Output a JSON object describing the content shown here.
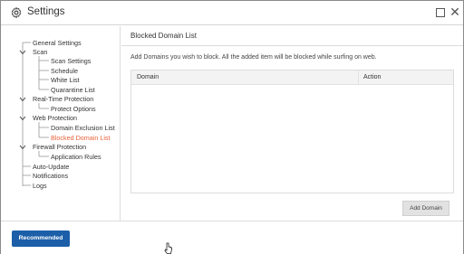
{
  "window": {
    "title": "Settings",
    "icon": "gear-icon"
  },
  "sidebar": {
    "items": [
      {
        "label": "General Settings",
        "level": 0
      },
      {
        "label": "Scan",
        "level": 0,
        "expandable": true
      },
      {
        "label": "Scan Settings",
        "level": 1
      },
      {
        "label": "Schedule",
        "level": 1
      },
      {
        "label": "White List",
        "level": 1
      },
      {
        "label": "Quarantine List",
        "level": 1
      },
      {
        "label": "Real-Time Protection",
        "level": 0,
        "expandable": true
      },
      {
        "label": "Protect Options",
        "level": 1
      },
      {
        "label": "Web Protection",
        "level": 0,
        "expandable": true
      },
      {
        "label": "Domain Exclusion List",
        "level": 1
      },
      {
        "label": "Blocked Domain List",
        "level": 1,
        "active": true
      },
      {
        "label": "Firewall Protection",
        "level": 0,
        "expandable": true
      },
      {
        "label": "Application Rules",
        "level": 1
      },
      {
        "label": "Auto-Update",
        "level": 0
      },
      {
        "label": "Notifications",
        "level": 0
      },
      {
        "label": "Logs",
        "level": 0
      }
    ]
  },
  "panel": {
    "title": "Blocked Domain List",
    "description": "Add Domains you wish to block. All the added item will be blocked while surfing on web.",
    "table": {
      "columns": [
        "Domain",
        "Action"
      ],
      "rows": []
    },
    "add_button": "Add Domain"
  },
  "footer": {
    "recommended_button": "Recommended"
  },
  "colors": {
    "accent": "#1c5fa8",
    "active_item": "#e8623c"
  }
}
